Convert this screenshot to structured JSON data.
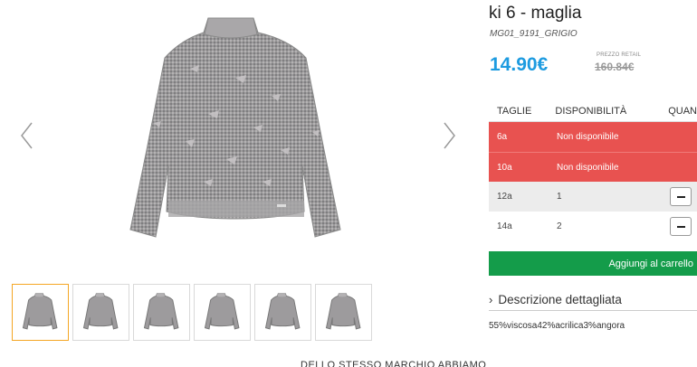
{
  "product": {
    "title": "ki 6 - maglia",
    "sku": "MG01_9191_GRIGIO",
    "price": "14.90€",
    "retail_label": "PREZZO RETAIL",
    "retail_price": "160.84€"
  },
  "gallery": {
    "prev_icon": "chevron-left-icon",
    "next_icon": "chevron-right-icon",
    "thumbnails": [
      "sweater-thumb-1",
      "sweater-thumb-2",
      "sweater-thumb-3",
      "sweater-thumb-4",
      "sweater-thumb-5",
      "sweater-thumb-6"
    ],
    "active_thumbnail": 0
  },
  "sizes": {
    "headers": [
      "TAGLIE",
      "DISPONIBILITÀ",
      "QUAN"
    ],
    "rows": [
      {
        "size": "6a",
        "availability": "Non disponibile",
        "available": false
      },
      {
        "size": "10a",
        "availability": "Non disponibile",
        "available": false
      },
      {
        "size": "12a",
        "availability": "1",
        "available": true
      },
      {
        "size": "14a",
        "availability": "2",
        "available": true
      }
    ]
  },
  "cart": {
    "label": "Aggiungi al carrello"
  },
  "description": {
    "toggle_label": "Descrizione dettagliata",
    "composition": "55%viscosa42%acrilica3%angora"
  },
  "below": {
    "text": "DELLO STESSO MARCHIO ABBIAMO"
  },
  "colors": {
    "price": "#1d9be0",
    "unavailable_row": "#e85250",
    "cart_button": "#149c4a",
    "active_thumb_border": "#f5a623"
  }
}
